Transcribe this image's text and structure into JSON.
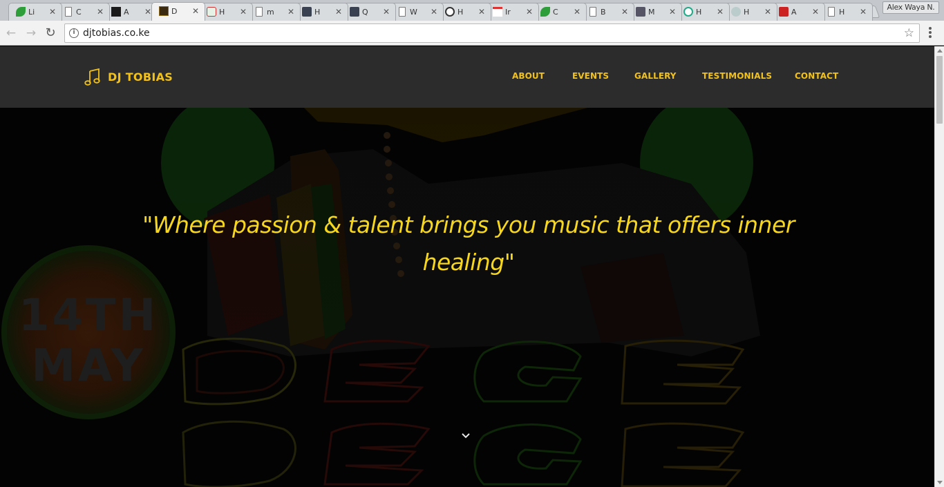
{
  "browser": {
    "tabs": [
      {
        "title": "Li",
        "icon": "leaf-icon"
      },
      {
        "title": "C",
        "icon": "document-icon"
      },
      {
        "title": "A",
        "icon": "dark-square-icon"
      },
      {
        "title": "D",
        "icon": "dj-logo-icon",
        "active": true
      },
      {
        "title": "H",
        "icon": "puzzle-icon"
      },
      {
        "title": "m",
        "icon": "document-icon"
      },
      {
        "title": "H",
        "icon": "screen-icon"
      },
      {
        "title": "Q",
        "icon": "screen-icon"
      },
      {
        "title": "W",
        "icon": "document-icon"
      },
      {
        "title": "H",
        "icon": "circle-logo-icon"
      },
      {
        "title": "Ir",
        "icon": "gmail-icon"
      },
      {
        "title": "C",
        "icon": "leaf-icon"
      },
      {
        "title": "B",
        "icon": "document-icon"
      },
      {
        "title": "M",
        "icon": "avatar-icon"
      },
      {
        "title": "H",
        "icon": "hub-icon"
      },
      {
        "title": "H",
        "icon": "gear-logo-icon"
      },
      {
        "title": "A",
        "icon": "red-logo-icon"
      },
      {
        "title": "H",
        "icon": "document-icon"
      }
    ],
    "close_glyph": "✕",
    "profile_name": "Alex Waya N.",
    "url": "djtobias.co.ke",
    "info_glyph": "i",
    "star_glyph": "☆",
    "back_glyph": "←",
    "forward_glyph": "→",
    "reload_glyph": "↻"
  },
  "site": {
    "brand": "DJ TOBIAS",
    "nav": [
      "ABOUT",
      "EVENTS",
      "GALLERY",
      "TESTIMONIALS",
      "CONTACT"
    ],
    "quote": "\"Where passion & talent brings you music that offers inner healing\"",
    "poster_date_line1": "14TH",
    "poster_date_line2": "MAY",
    "accent_color": "#f2c21b",
    "header_bg": "#2c2c2c"
  }
}
